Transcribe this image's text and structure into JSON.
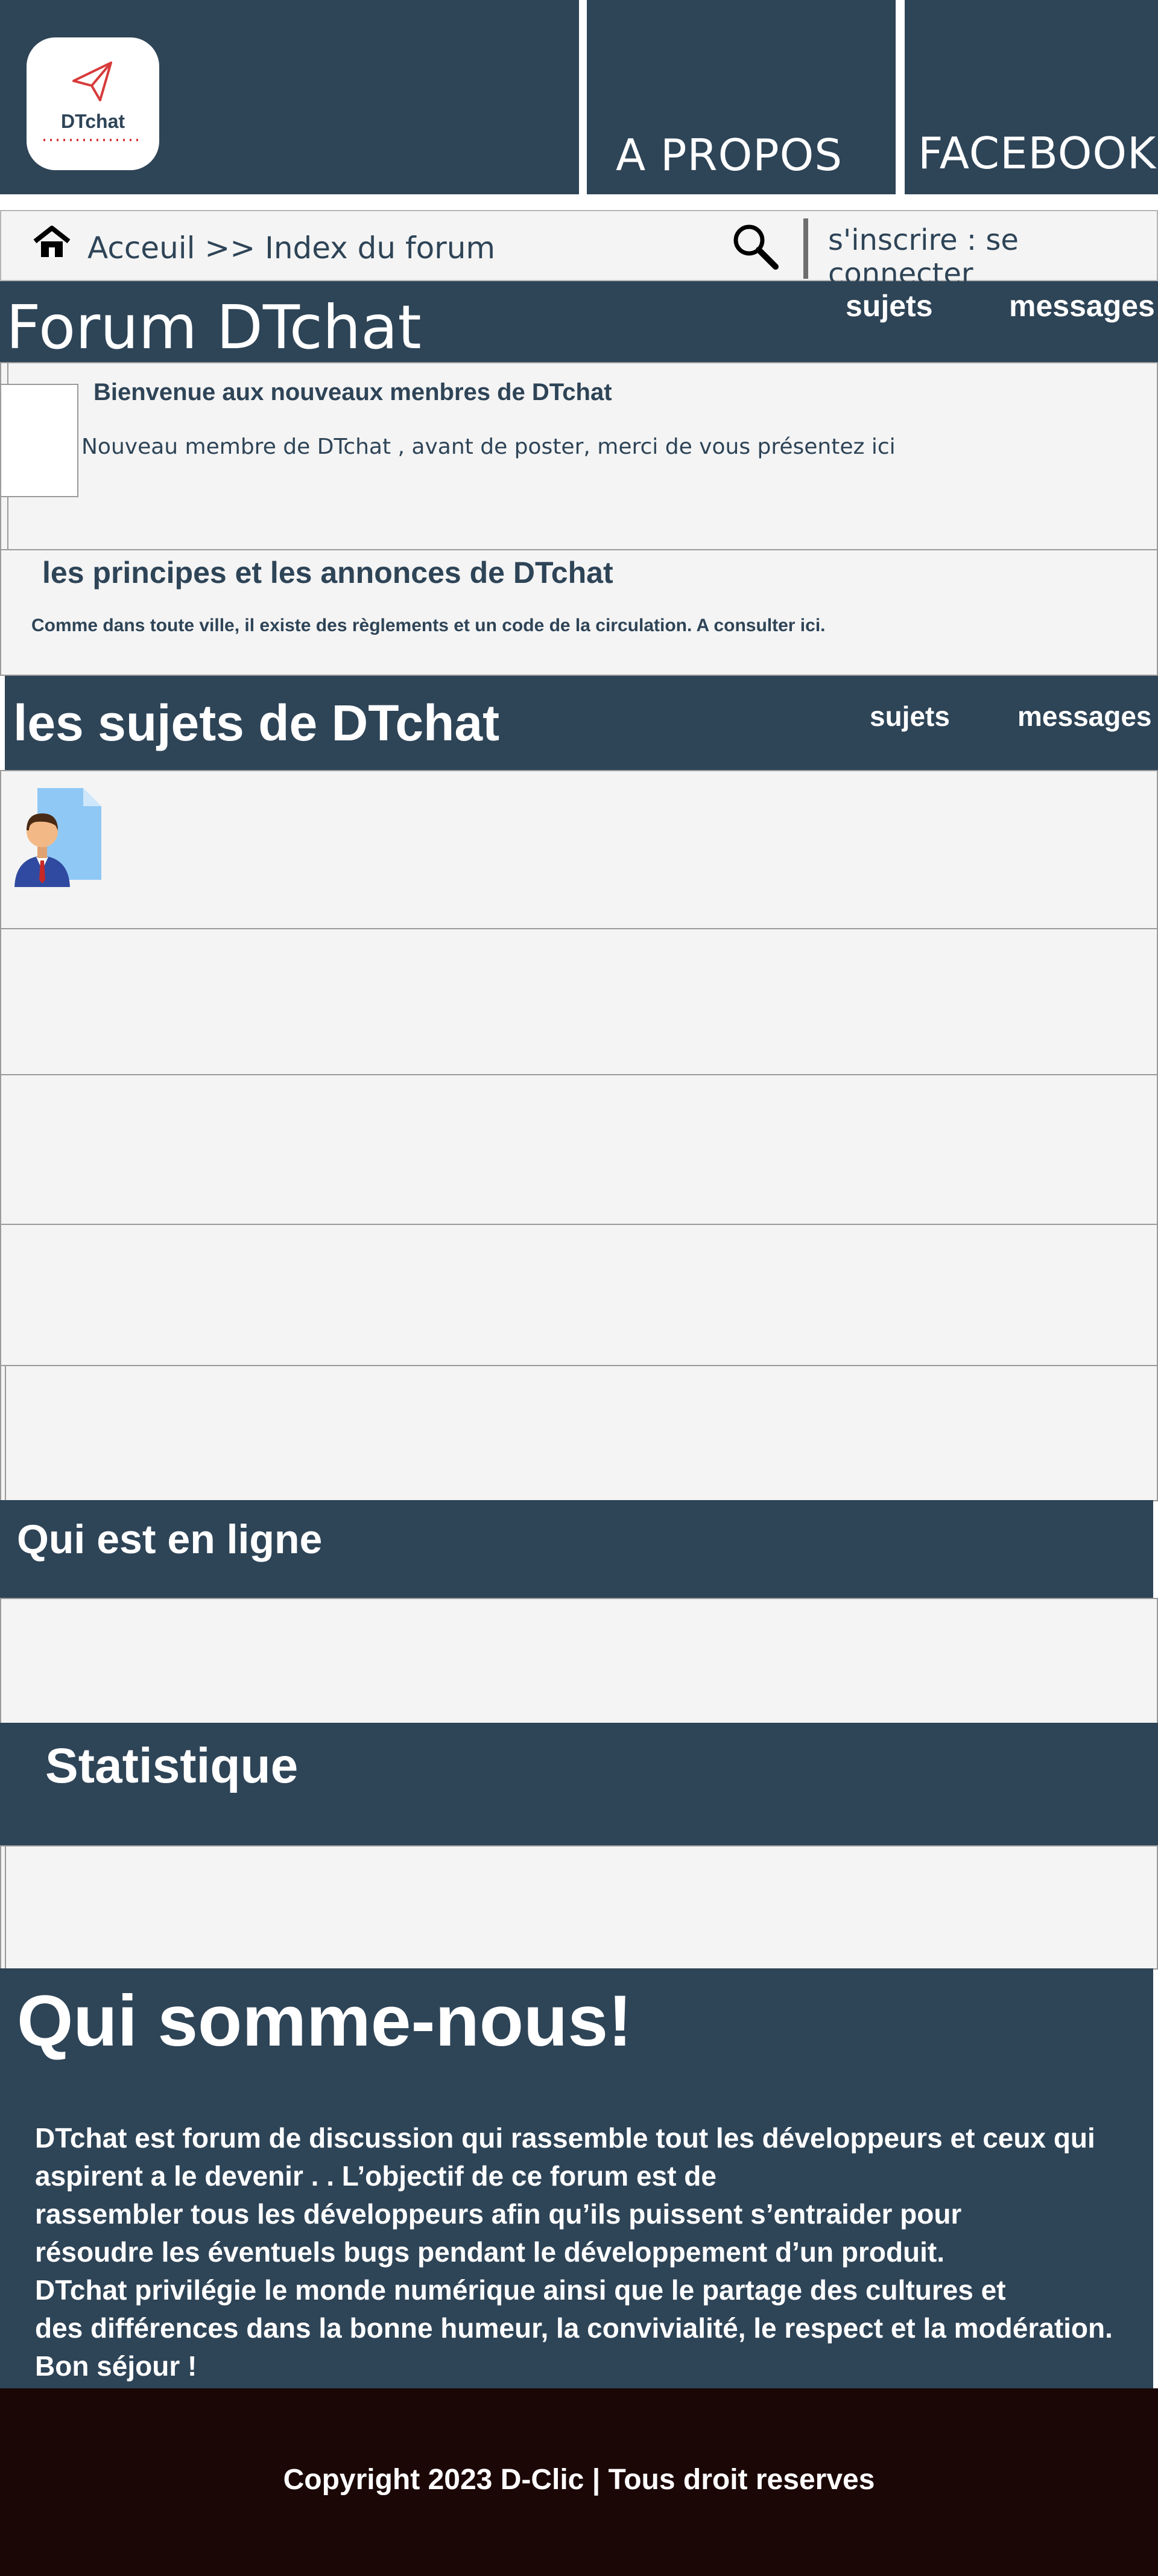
{
  "header": {
    "logo_text": "DTchat",
    "nav_about": "A PROPOS",
    "nav_facebook": "FACEBOOK"
  },
  "breadcrumb": {
    "text": "Acceuil >> Index du forum",
    "auth": "s'inscrire :  se connecter"
  },
  "forum": {
    "title": "Forum DTchat",
    "col_subjects": "sujets",
    "col_messages": "messages",
    "welcome_title": "Bienvenue aux nouveaux menbres de DTchat",
    "welcome_desc": "Nouveau membre de DTchat , avant de poster, merci de vous présentez ici",
    "principles_title": "les principes et les annonces de DTchat",
    "principles_desc": "Comme dans toute ville, il existe des règlements et un code de la circulation. A consulter ici."
  },
  "subjects": {
    "title": "les sujets de DTchat",
    "col_subjects": "sujets",
    "col_messages": "messages"
  },
  "online": {
    "title": "Qui est en ligne"
  },
  "stats": {
    "title": "Statistique"
  },
  "about": {
    "title": "Qui somme-nous!",
    "text": "DTchat est forum de discussion qui rassemble tout les développeurs et ceux qui\naspirent a le devenir . . L’objectif de ce forum est de\nrassembler tous les développeurs afin qu’ils puissent s’entraider pour\nrésoudre les éventuels bugs pendant le développement d’un produit.\nDTchat privilégie  le monde numérique ainsi que le partage des cultures et\n des différences dans la bonne humeur, la convivialité, le respect et la modération.\nBon séjour !"
  },
  "footer": {
    "copyright": "Copyright 2023 D-Clic | Tous droit reserves"
  },
  "colors": {
    "navy": "#2e4457",
    "light": "#f4f4f4",
    "footer": "#1c0707",
    "logo_red": "#d83a3a"
  },
  "icons": {
    "home": "home-icon",
    "search": "search-icon",
    "send": "paper-plane-icon",
    "user": "user-document-icon"
  }
}
